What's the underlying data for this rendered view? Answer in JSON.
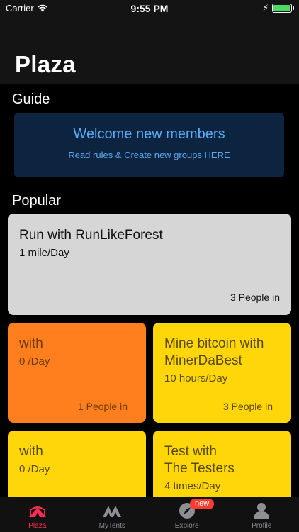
{
  "status_bar": {
    "carrier": "Carrier",
    "time": "9:55 PM",
    "battery_level": 0.95
  },
  "header": {
    "title": "Plaza"
  },
  "sections": {
    "guide": "Guide",
    "popular": "Popular"
  },
  "guide_card": {
    "title": "Welcome new members",
    "subtitle": "Read rules & Create new groups HERE"
  },
  "cards": [
    {
      "title": "Run with RunLikeForest",
      "rate": "1  mile/Day",
      "people": "3 People in",
      "color": "#d6d6d6",
      "text_color": "#111111"
    },
    {
      "title": " with",
      "rate": "0  /Day",
      "people": "1 People in",
      "color": "#ff7f1e",
      "text_color": "#6a3a00"
    },
    {
      "title": "Mine bitcoin with\nMinerDaBest",
      "rate": "10  hours/Day",
      "people": "3 People in",
      "color": "#ffd60a",
      "text_color": "#5a4a00"
    },
    {
      "title": " with",
      "rate": "0  /Day",
      "people": "",
      "color": "#ffd60a",
      "text_color": "#5a4a00"
    },
    {
      "title": "Test with\nThe Testers",
      "rate": "4  times/Day",
      "people": "",
      "color": "#ffd60a",
      "text_color": "#5a4a00"
    }
  ],
  "tabs": [
    {
      "label": "Plaza",
      "icon": "plaza-tent-icon",
      "active": true
    },
    {
      "label": "MyTents",
      "icon": "tents-icon",
      "active": false
    },
    {
      "label": "Explore",
      "icon": "compass-icon",
      "active": false,
      "badge": "new"
    },
    {
      "label": "Profile",
      "icon": "person-icon",
      "active": false
    }
  ],
  "colors": {
    "accent": "#ff2d55",
    "guide_bg": "#0d2440",
    "guide_text": "#5aabf2"
  }
}
